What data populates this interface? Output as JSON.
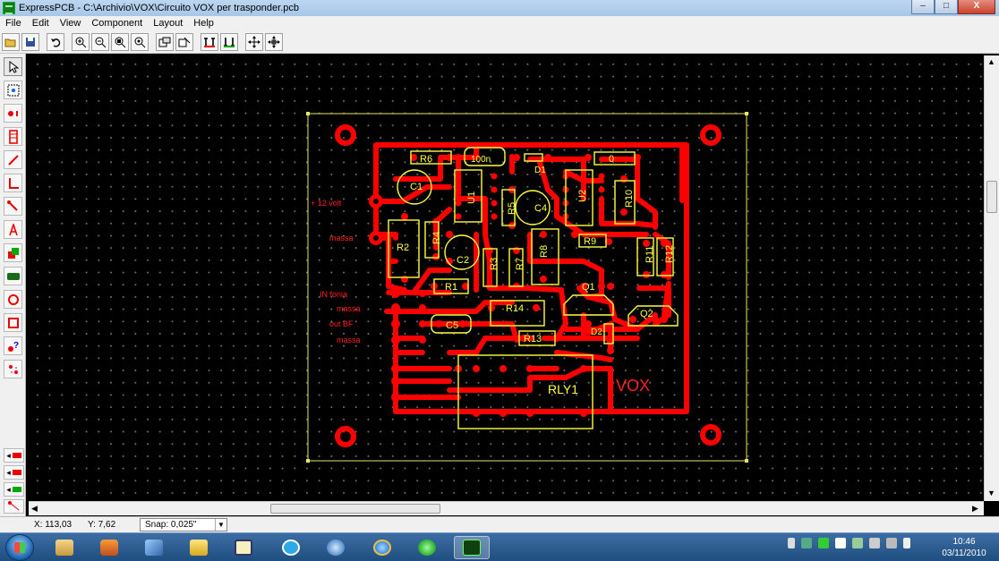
{
  "window": {
    "title": "ExpressPCB - C:\\Archivio\\VOX\\Circuito VOX per trasponder.pcb",
    "controls": [
      "–",
      "□",
      "X"
    ]
  },
  "menu": [
    "File",
    "Edit",
    "View",
    "Component",
    "Layout",
    "Help"
  ],
  "toolbar": {
    "buttons": [
      "open-icon",
      "save-icon",
      "undo-icon",
      "zoom-in-icon",
      "zoom-out-icon",
      "zoom-area-icon",
      "zoom-fit-icon",
      "component-properties-icon",
      "pad-properties-icon",
      "top-layer-icon",
      "bottom-layer-icon",
      "move-icon",
      "move-all-icon"
    ]
  },
  "palette": {
    "tools": [
      "select-icon",
      "select-area-icon",
      "place-pad-icon",
      "place-component-icon",
      "trace-icon",
      "trace-corner-icon",
      "trace-diagonal-icon",
      "text-icon",
      "filled-shape-icon",
      "rectangle-icon",
      "circle-icon",
      "square-icon",
      "mark-icon",
      "rotate-icon"
    ],
    "layers": [
      "top-layer-icon",
      "bottom-layer-icon",
      "silkscreen-layer-icon",
      "ratsnest-icon"
    ]
  },
  "pcb": {
    "labels": {
      "plus_12_volt": "+ 12 volt",
      "massa_1": "massa",
      "in_fonia": "IN fonia",
      "massa_2": "massa",
      "out_bf": "out BF",
      "massa_3": "massa",
      "vox": "VOX"
    },
    "components": {
      "r6": "R6",
      "c100n": "100n",
      "d1": "D1",
      "r0": "0",
      "c1": "C1",
      "u1": "U1",
      "r5": "R5",
      "c4": "C4",
      "u2": "U2",
      "r10": "R10",
      "r2": "R2",
      "r4": "R4",
      "c2": "C2",
      "r3": "R3",
      "r7": "R7",
      "r8": "R8",
      "r9": "R9",
      "r11": "R11",
      "r12": "R12",
      "r1": "R1",
      "q1": "Q1",
      "r14": "R14",
      "q2": "Q2",
      "c5": "C5",
      "d2": "D2",
      "r13": "R13",
      "rly1": "RLY1"
    },
    "colors": {
      "trace": "#ff0000",
      "silkscreen": "#ffff40",
      "board": "#e8e860",
      "background": "#000000"
    }
  },
  "status": {
    "x": "X: 113,03",
    "y": "Y: 7,62",
    "snap": "Snap: 0,025\""
  },
  "taskbar": {
    "apps": [
      "explorer-icon",
      "media-player-icon",
      "tools-icon",
      "folder-icon",
      "schematic-icon",
      "skype-icon",
      "network-icon",
      "internet-explorer-icon",
      "green-app-icon",
      "expresspcb-icon"
    ],
    "clock_time": "10:46",
    "clock_date": "03/11/2010"
  }
}
